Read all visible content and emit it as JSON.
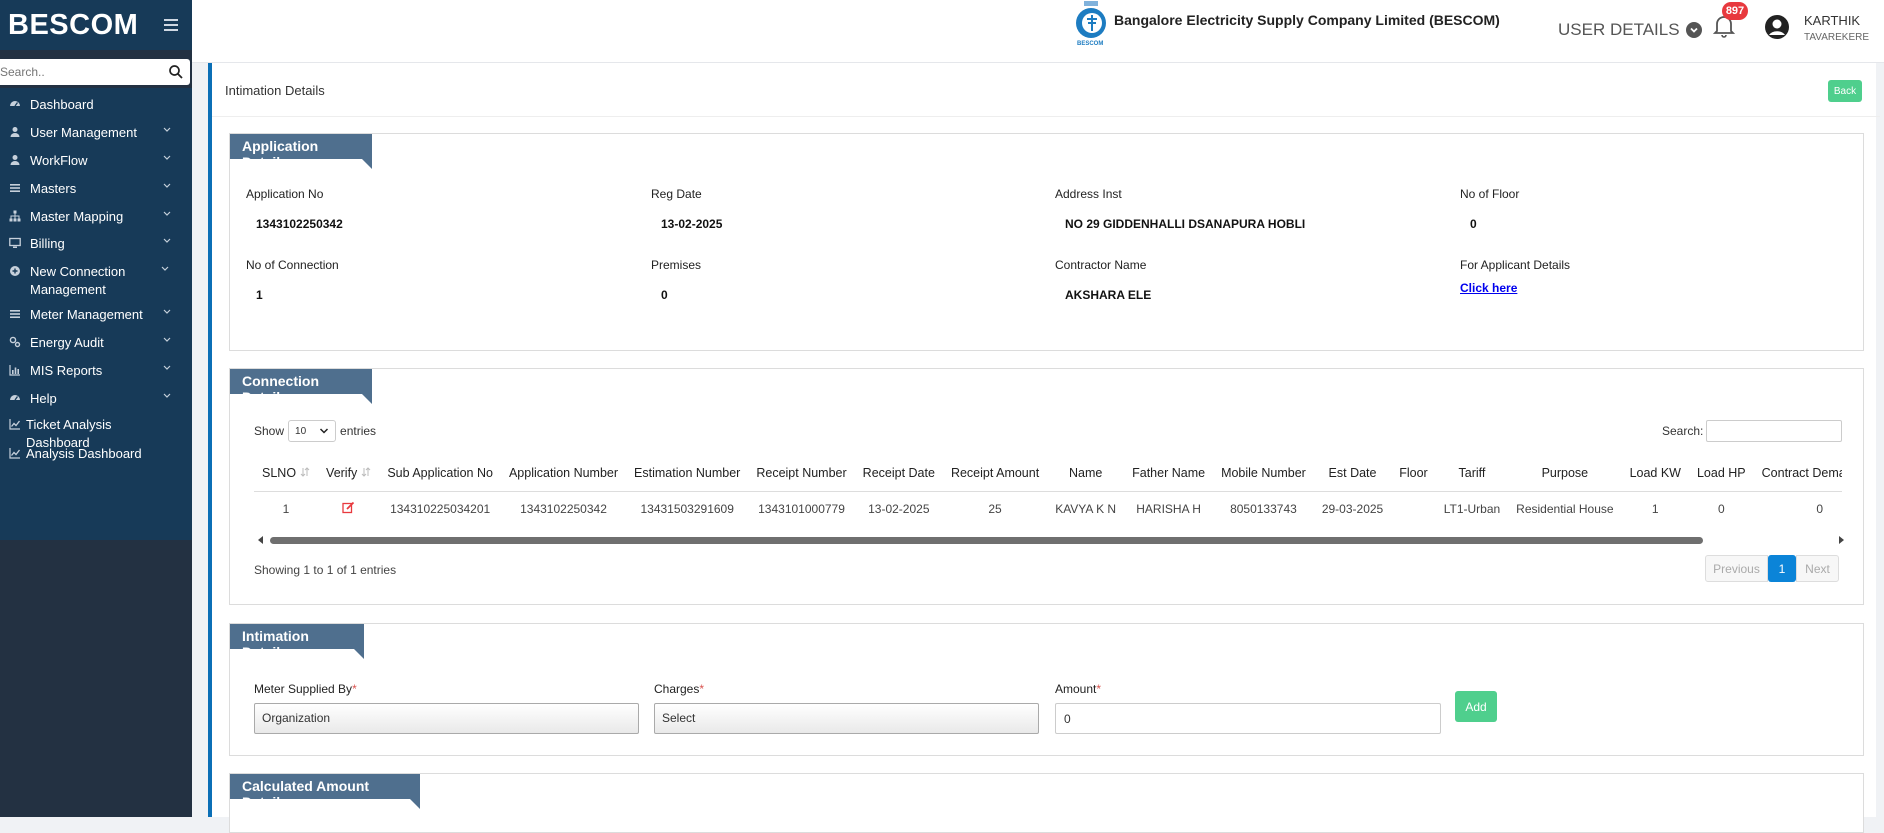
{
  "sidebar": {
    "brand": "BESCOM",
    "search_placeholder": "Search..",
    "items": [
      {
        "label": "Dashboard",
        "icon": "dashboard-icon",
        "has_children": false
      },
      {
        "label": "User Management",
        "icon": "user-icon",
        "has_children": true
      },
      {
        "label": "WorkFlow",
        "icon": "user-icon",
        "has_children": true
      },
      {
        "label": "Masters",
        "icon": "list-icon",
        "has_children": true
      },
      {
        "label": "Master Mapping",
        "icon": "sitemap-icon",
        "has_children": true
      },
      {
        "label": "Billing",
        "icon": "monitor-icon",
        "has_children": true
      },
      {
        "label": "New Connection Management",
        "icon": "plus-circle-icon",
        "has_children": true
      },
      {
        "label": "Meter Management",
        "icon": "list-icon",
        "has_children": true
      },
      {
        "label": "Energy Audit",
        "icon": "gears-icon",
        "has_children": true
      },
      {
        "label": "MIS Reports",
        "icon": "bar-chart-icon",
        "has_children": true
      },
      {
        "label": "Help",
        "icon": "dashboard-icon",
        "has_children": true
      },
      {
        "label": "Ticket Analysis Dashboard",
        "icon": "line-chart-icon",
        "has_children": false
      },
      {
        "label": "Analysis Dashboard",
        "icon": "line-chart-icon",
        "has_children": false
      }
    ]
  },
  "header": {
    "logo_caption": "BESCOM",
    "company": "Bangalore Electricity Supply Company Limited (BESCOM)",
    "user_details": "USER DETAILS",
    "notification_count": "897",
    "user_name": "KARTHIK",
    "user_location": "TAVAREKERE"
  },
  "page": {
    "title": "Intimation Details",
    "back_label": "Back"
  },
  "application_details": {
    "title": "Application Details",
    "fields": [
      {
        "label": "Application No",
        "value": "1343102250342"
      },
      {
        "label": "Reg Date",
        "value": "13-02-2025"
      },
      {
        "label": "Address Inst",
        "value": "NO 29 GIDDENHALLI DSANAPURA HOBLI"
      },
      {
        "label": "No of Floor",
        "value": "0"
      },
      {
        "label": "No of Connection",
        "value": "1"
      },
      {
        "label": "Premises",
        "value": "0"
      },
      {
        "label": "Contractor Name",
        "value": "AKSHARA ELE"
      },
      {
        "label": "For Applicant Details",
        "value": "Click here"
      }
    ]
  },
  "connection_details": {
    "title": "Connection Details",
    "show_label": "Show",
    "entries_value": "10",
    "entries_label": "entries",
    "search_label": "Search:",
    "columns": [
      "SLNO",
      "Verify",
      "Sub Application No",
      "Application Number",
      "Estimation Number",
      "Receipt Number",
      "Receipt Date",
      "Receipt Amount",
      "Name",
      "Father Name",
      "Mobile Number",
      "Est Date",
      "Floor",
      "Tariff",
      "Purpose",
      "Load KW",
      "Load HP",
      "Contract Demand Kv"
    ],
    "rows": [
      [
        "1",
        "",
        "134310225034201",
        "1343102250342",
        "13431503291609",
        "1343101000779",
        "13-02-2025",
        "25",
        "KAVYA K N",
        "HARISHA H",
        "8050133743",
        "29-03-2025",
        "",
        "LT1-Urban",
        "Residential House",
        "1",
        "0",
        "0"
      ]
    ],
    "info": "Showing 1 to 1 of 1 entries",
    "pagination": {
      "previous": "Previous",
      "current": "1",
      "next": "Next"
    }
  },
  "intimation_details": {
    "title": "Intimation Details",
    "meter_supplied_by_label": "Meter Supplied By",
    "meter_supplied_by_value": "Organization",
    "charges_label": "Charges",
    "charges_value": "Select",
    "amount_label": "Amount",
    "amount_value": "0",
    "add_label": "Add",
    "required_mark": "*"
  },
  "calculated_amount": {
    "title": "Calculated Amount Details"
  },
  "colors": {
    "sidebar_bg": "#173a58",
    "section_title_bg": "#4f6f8e",
    "accent_green": "#4fcf8d",
    "badge_red": "#e8393e",
    "page_active": "#0b84d8"
  }
}
